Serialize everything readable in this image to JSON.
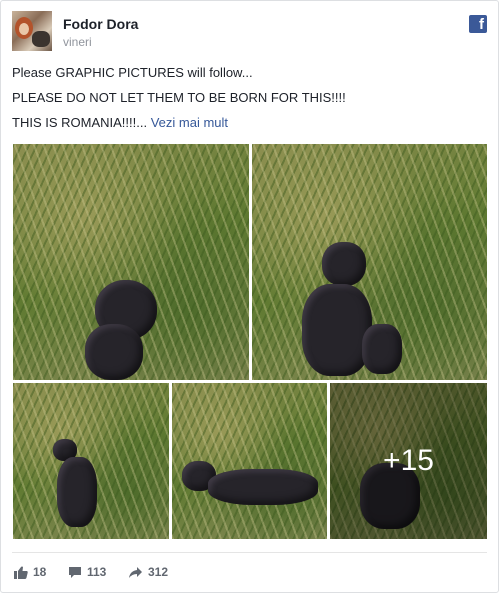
{
  "post": {
    "author": "Fodor Dora",
    "date": "vineri",
    "lines": [
      "Please GRAPHIC PICTURES will follow...",
      "PLEASE DO NOT LET THEM TO BE BORN FOR THIS!!!!",
      "THIS IS ROMANIA!!!!..."
    ],
    "see_more": "Vezi mai mult",
    "more_photos_label": "+15"
  },
  "icons": {
    "brand": "facebook-icon",
    "like": "thumbs-up-icon",
    "comment": "comment-bubble-icon",
    "share": "share-arrow-icon"
  },
  "stats": {
    "likes": "18",
    "comments": "113",
    "shares": "312"
  },
  "colors": {
    "link": "#365899",
    "brand": "#3b5998",
    "text": "#1d2129",
    "muted": "#90949c",
    "stat": "#616770"
  }
}
